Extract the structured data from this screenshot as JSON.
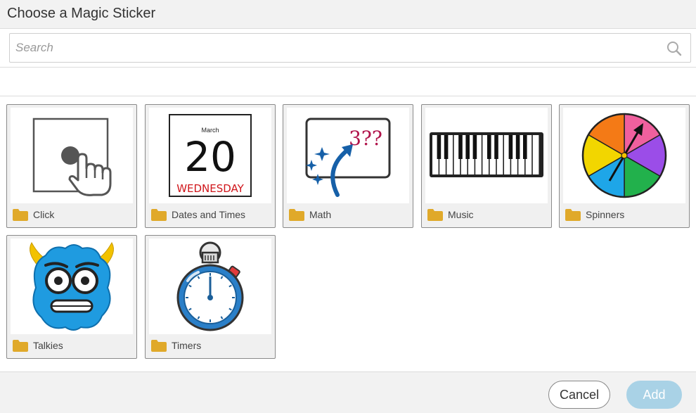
{
  "dialog": {
    "title": "Choose a Magic Sticker"
  },
  "search": {
    "placeholder": "Search",
    "value": ""
  },
  "tiles": [
    {
      "label": "Click",
      "icon": "click-hand-icon"
    },
    {
      "label": "Dates and Times",
      "icon": "calendar-icon",
      "calendar": {
        "month": "March",
        "day": "20",
        "weekday": "WEDNESDAY"
      }
    },
    {
      "label": "Math",
      "icon": "math-board-icon",
      "math_text": "3??"
    },
    {
      "label": "Music",
      "icon": "piano-keyboard-icon"
    },
    {
      "label": "Spinners",
      "icon": "color-spinner-icon"
    },
    {
      "label": "Talkies",
      "icon": "blue-monster-icon"
    },
    {
      "label": "Timers",
      "icon": "stopwatch-icon"
    }
  ],
  "footer": {
    "cancel_label": "Cancel",
    "add_label": "Add"
  },
  "colors": {
    "folder": "#e0a92a",
    "add_button": "#a9d2e6",
    "header_bg": "#f2f2f2"
  }
}
